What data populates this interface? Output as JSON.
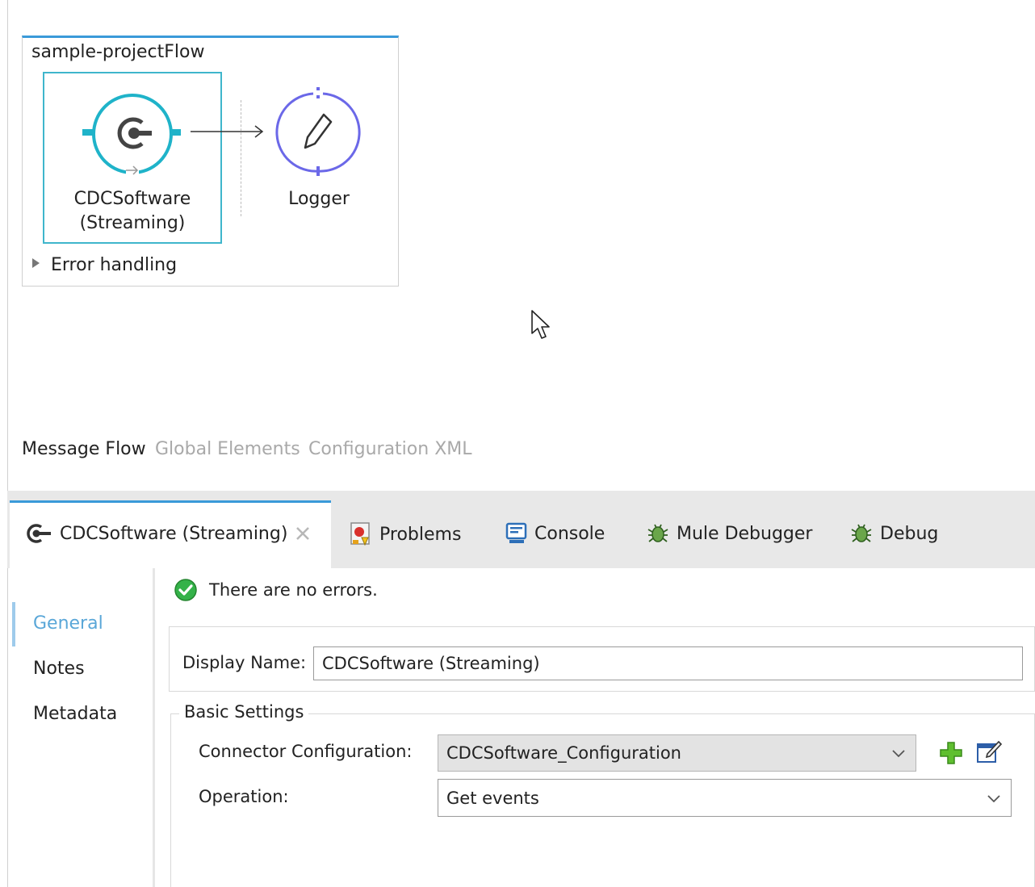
{
  "flow": {
    "title": "sample-projectFlow",
    "source_line1": "CDCSoftware",
    "source_line2": "(Streaming)",
    "processor": "Logger",
    "error_handling": "Error handling"
  },
  "editor_tabs": [
    "Message Flow",
    "Global Elements",
    "Configuration XML"
  ],
  "panel_tabs": {
    "active": "CDCSoftware (Streaming)",
    "problems": "Problems",
    "console": "Console",
    "mule_debugger": "Mule Debugger",
    "debug": "Debug"
  },
  "sidebar": {
    "items": [
      {
        "label": "General",
        "active": true
      },
      {
        "label": "Notes",
        "active": false
      },
      {
        "label": "Metadata",
        "active": false
      }
    ]
  },
  "status": "There are no errors.",
  "form": {
    "display_name_label": "Display Name:",
    "display_name_value": "CDCSoftware (Streaming)",
    "basic_settings": "Basic Settings",
    "connector_config_label": "Connector Configuration:",
    "connector_config_value": "CDCSoftware_Configuration",
    "operation_label": "Operation:",
    "operation_value": "Get events"
  },
  "colors": {
    "accent": "#3a9ad9",
    "source": "#1fb3c9",
    "logger": "#6b68e8",
    "sidebar_active": "#5aa7d8",
    "success": "#34b249",
    "add": "#5fbf2f"
  }
}
